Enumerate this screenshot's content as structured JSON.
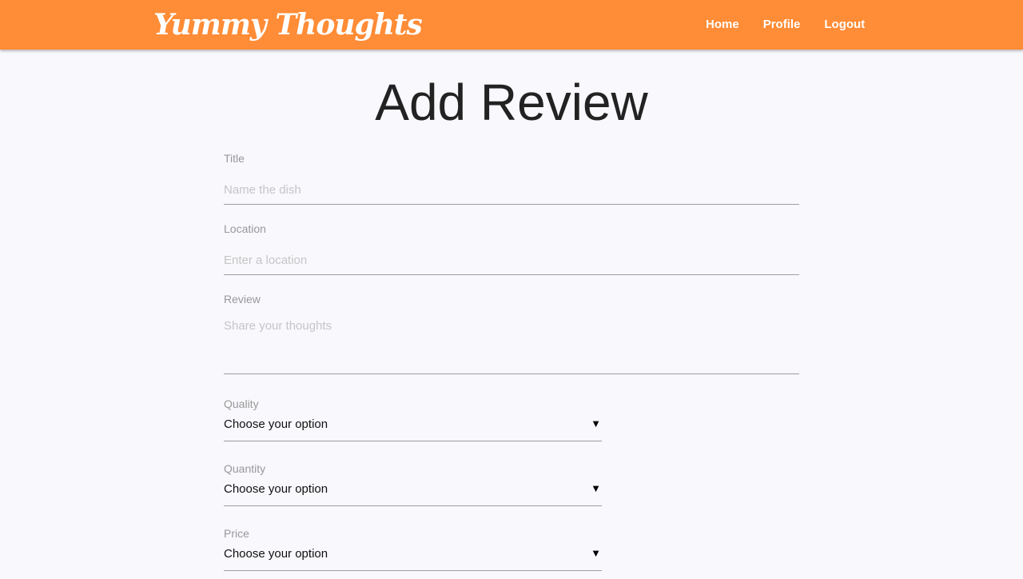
{
  "header": {
    "brand": "Yummy Thoughts",
    "nav": [
      {
        "label": "Home"
      },
      {
        "label": "Profile"
      },
      {
        "label": "Logout"
      }
    ],
    "background": "#ff8c36"
  },
  "page": {
    "title": "Add Review"
  },
  "form": {
    "title": {
      "label": "Title",
      "placeholder": "Name the dish",
      "value": ""
    },
    "location": {
      "label": "Location",
      "placeholder": "Enter a location",
      "value": ""
    },
    "review": {
      "label": "Review",
      "placeholder": "Share your thoughts",
      "value": ""
    },
    "quality": {
      "label": "Quality",
      "selected": "Choose your option"
    },
    "quantity": {
      "label": "Quantity",
      "selected": "Choose your option"
    },
    "price": {
      "label": "Price",
      "selected": "Choose your option"
    },
    "caret_glyph": "▼"
  }
}
